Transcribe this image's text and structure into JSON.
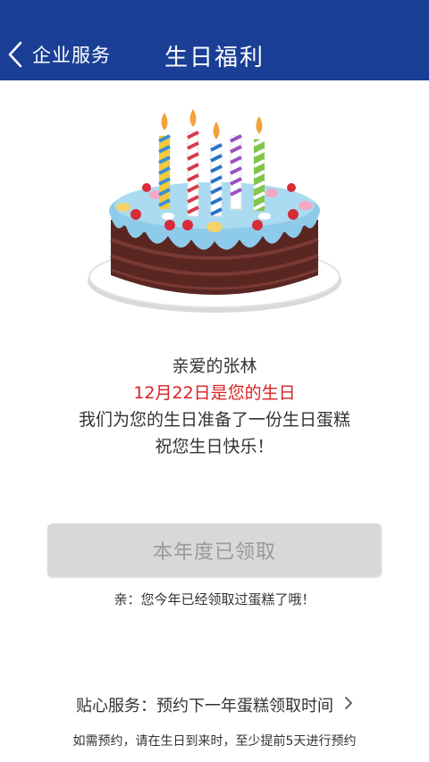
{
  "header": {
    "back_label": "企业服务",
    "title": "生日福利",
    "bg_color": "#1b3f96"
  },
  "illustration": {
    "icon": "birthday-cake-icon",
    "candles": 5
  },
  "message": {
    "greeting": "亲爱的张林",
    "birthday_line": "12月22日是您的生日",
    "gift_line": "我们为您的生日准备了一份生日蛋糕",
    "wish_line": "祝您生日快乐！",
    "highlight_color": "#d92020"
  },
  "claim": {
    "button_label": "本年度已领取",
    "disabled": true,
    "note": "亲：您今年已经领取过蛋糕了哦！"
  },
  "service": {
    "label": "贴心服务：预约下一年蛋糕领取时间",
    "footnote": "如需预约，请在生日到来时，至少提前5天进行预约"
  }
}
